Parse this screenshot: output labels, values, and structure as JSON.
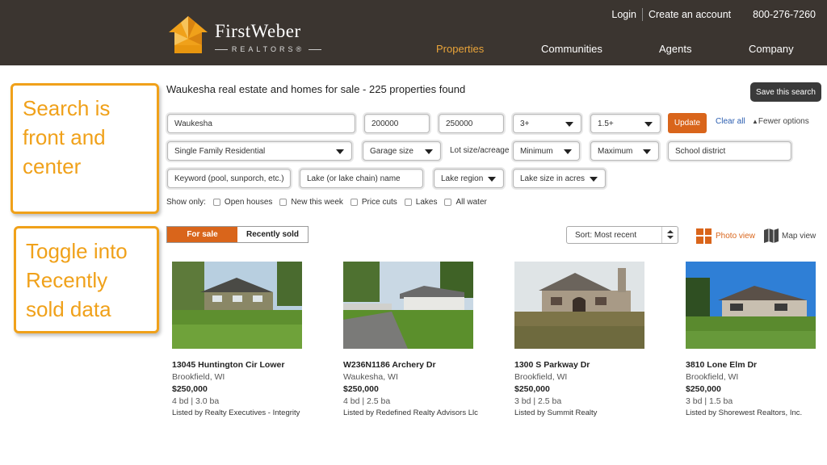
{
  "brand": {
    "name": "FirstWeber",
    "sub": "REALTORS®",
    "colors": {
      "header_bg": "#3b3530",
      "accent": "#d9651b",
      "logo": "#f0a11a",
      "link": "#2a5db0"
    }
  },
  "top_links": {
    "login": "Login",
    "create_account": "Create an account",
    "phone": "800-276-7260"
  },
  "nav": {
    "items": [
      "Properties",
      "Communities",
      "Agents",
      "Company"
    ],
    "active": "Properties"
  },
  "callouts": {
    "search": "Search is front and center",
    "toggle": "Toggle into Recently sold data"
  },
  "search": {
    "results_title": "Waukesha real estate and homes for sale - 225 properties found",
    "save_button": "Save this search",
    "location": "Waukesha",
    "min_price": "200000",
    "max_price": "250000",
    "beds": "3+",
    "baths": "1.5+",
    "update_button": "Update",
    "clear_all": "Clear all",
    "fewer_options": "Fewer options",
    "property_type": "Single Family Residential",
    "garage": "Garage size",
    "lot_size_label": "Lot size/acreage",
    "lot_min": "Minimum",
    "lot_max": "Maximum",
    "school_district_placeholder": "School district",
    "keyword_placeholder": "Keyword (pool, sunporch, etc.)",
    "lake_placeholder": "Lake (or lake chain) name",
    "lake_region": "Lake region",
    "lake_size": "Lake size in acres",
    "show_only_label": "Show only:",
    "show_only_options": [
      "Open houses",
      "New this week",
      "Price cuts",
      "Lakes",
      "All water"
    ]
  },
  "results_bar": {
    "toggle": {
      "for_sale": "For sale",
      "recently_sold": "Recently sold",
      "selected": "For sale"
    },
    "sort": "Sort: Most recent",
    "photo_view": "Photo view",
    "map_view": "Map view"
  },
  "listings": [
    {
      "address": "13045 Huntington Cir Lower",
      "city": "Brookfield, WI",
      "price": "$250,000",
      "beds_baths": "4 bd | 3.0 ba",
      "listed_by": "Listed by Realty Executives - Integrity"
    },
    {
      "address": "W236N1186 Archery Dr",
      "city": "Waukesha, WI",
      "price": "$250,000",
      "beds_baths": "4 bd | 2.5 ba",
      "listed_by": "Listed by Redefined Realty Advisors Llc"
    },
    {
      "address": "1300 S Parkway Dr",
      "city": "Brookfield, WI",
      "price": "$250,000",
      "beds_baths": "3 bd | 2.5 ba",
      "listed_by": "Listed by Summit Realty"
    },
    {
      "address": "3810 Lone Elm Dr",
      "city": "Brookfield, WI",
      "price": "$250,000",
      "beds_baths": "3 bd | 1.5 ba",
      "listed_by": "Listed by Shorewest Realtors, Inc."
    }
  ]
}
